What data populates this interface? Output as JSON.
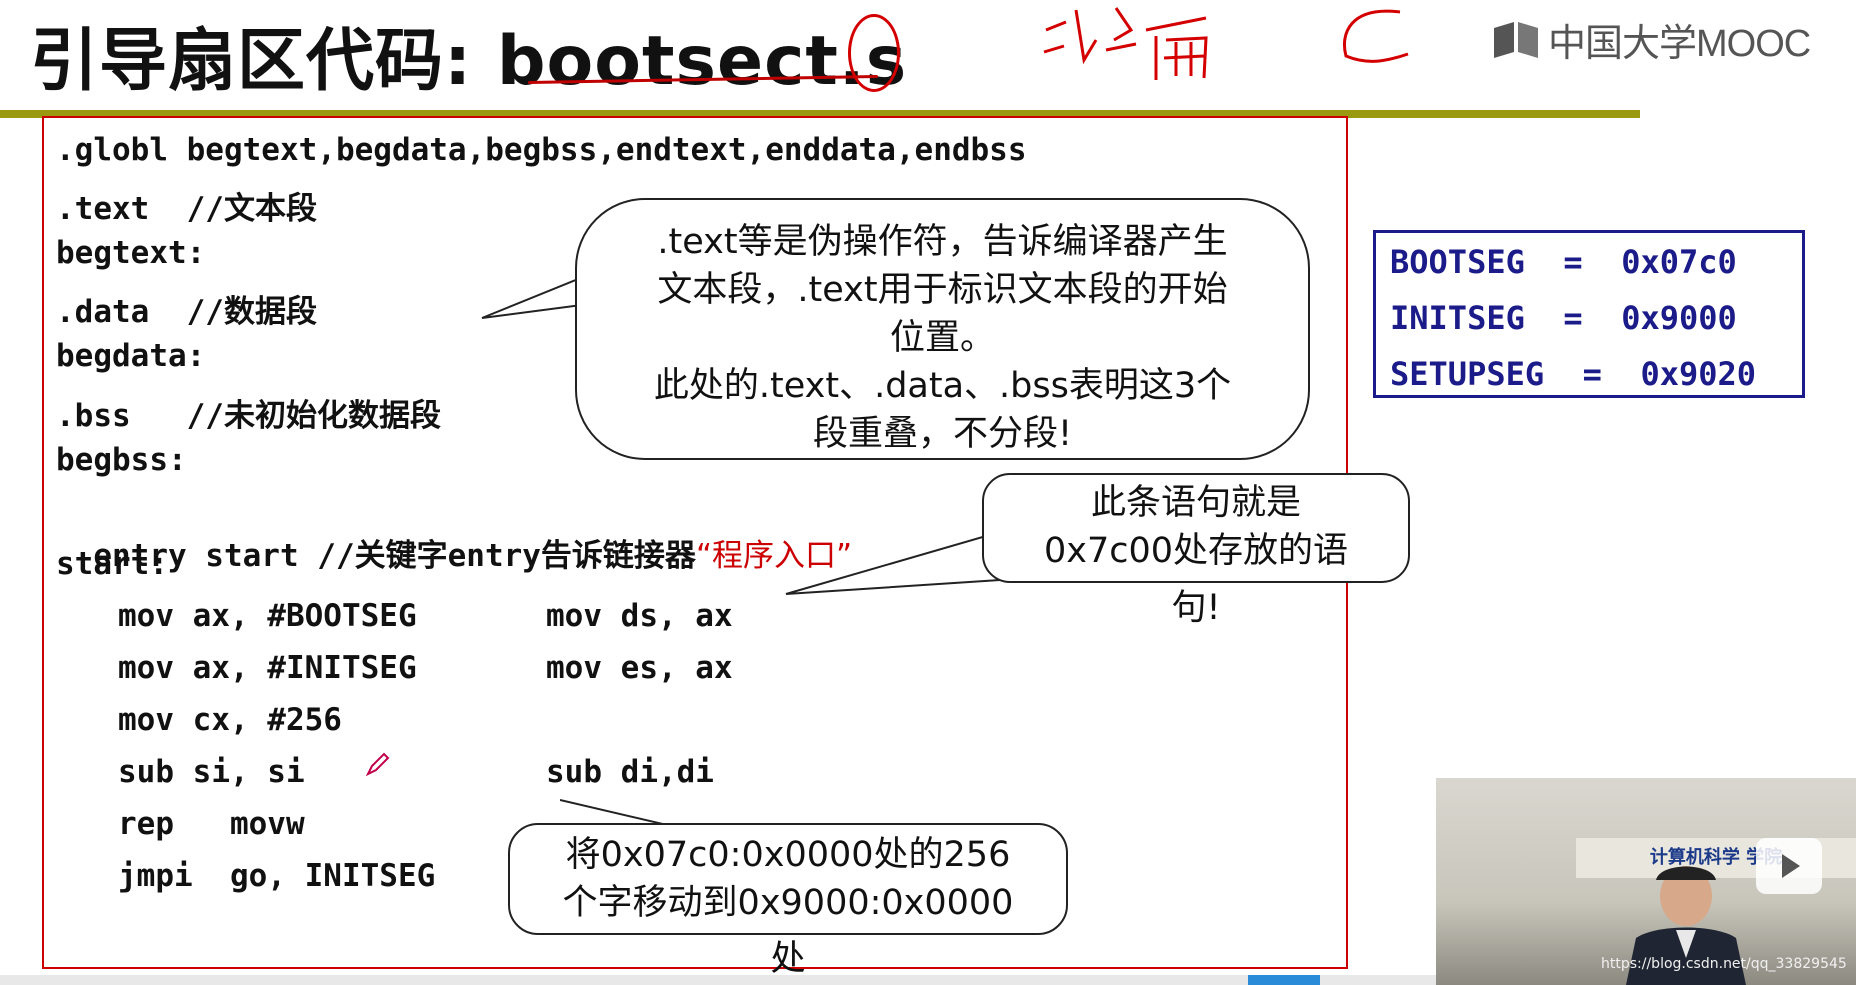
{
  "slide": {
    "title": "引导扇区代码: bootsect.s",
    "logo_text": "中国大学MOOC",
    "handwritten": [
      "汇编",
      "C"
    ]
  },
  "code": {
    "lines": [
      ".globl begtext,begdata,begbss,endtext,enddata,endbss",
      ".text  //文本段",
      "begtext:",
      ".data  //数据段",
      "begdata:",
      ".bss   //未初始化数据段",
      "begbss:",
      "entry start //关键字entry告诉链接器",
      "start:"
    ],
    "entry_quote": "“程序入口”",
    "indented": {
      "l1a": "mov ax, #BOOTSEG",
      "l1b": "mov ds, ax",
      "l2a": "mov ax, #INITSEG",
      "l2b": "mov es, ax",
      "l3a": "mov cx, #256",
      "l4a": "sub si, si",
      "l4b": "sub di,di",
      "l5a": "rep   movw",
      "l6a": "jmpi  go, INITSEG"
    }
  },
  "callouts": {
    "text_note": {
      "line1": ".text等是伪操作符，告诉编译器产生",
      "line2": "文本段，.text用于标识文本段的开始",
      "line3": "位置。",
      "line4": "此处的.text、.data、.bss表明这3个",
      "line5": "段重叠，不分段!"
    },
    "start_note": {
      "line1": "此条语句就是",
      "line2": "0x7c00处存放的语",
      "line3": "句!"
    },
    "move_note": {
      "line1": "将0x07c0:0x0000处的256",
      "line2": "个字移动到0x9000:0x0000",
      "line3": "处"
    }
  },
  "segments": {
    "bootseg": "BOOTSEG  =  0x07c0",
    "initseg": "INITSEG  =  0x9000",
    "setupseg": "SETUPSEG  =  0x9020"
  },
  "video": {
    "banner": "计算机科学  学院",
    "watermark": "https://blog.csdn.net/qq_33829545"
  },
  "colors": {
    "accent_red": "#cc0000",
    "segment_blue": "#1b1b8a",
    "divider_olive": "#9a9a10"
  }
}
